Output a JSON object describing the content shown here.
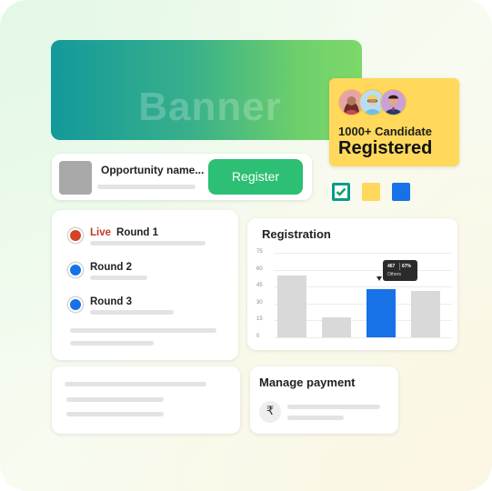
{
  "banner": {
    "text": "Banner"
  },
  "candidate": {
    "count": "1000+ Candidate",
    "status": "Registered"
  },
  "color_chips": [
    "#0a9c8c",
    "#ffd85c",
    "#1672e6"
  ],
  "opportunity": {
    "name": "Opportunity name...",
    "register_label": "Register"
  },
  "rounds": {
    "live_label": "Live",
    "items": [
      {
        "label": "Round 1",
        "dot_color": "#d44325"
      },
      {
        "label": "Round 2",
        "dot_color": "#1672e6"
      },
      {
        "label": "Round 3",
        "dot_color": "#1672e6"
      }
    ]
  },
  "registration": {
    "title": "Registration",
    "y_ticks": [
      "75",
      "60",
      "45",
      "30",
      "15",
      "0"
    ],
    "tooltip": {
      "value": "467",
      "percent": "67%",
      "label": "Others"
    }
  },
  "chart_data": {
    "type": "bar",
    "title": "Registration",
    "categories": [
      "",
      "",
      "",
      ""
    ],
    "values": [
      55,
      18,
      43,
      41
    ],
    "ylim": [
      0,
      75
    ],
    "highlight_index": 2,
    "colors": {
      "default": "#d9d9d9",
      "highlight": "#1672e6"
    }
  },
  "payment": {
    "title": "Manage payment",
    "currency_symbol": "₹"
  }
}
